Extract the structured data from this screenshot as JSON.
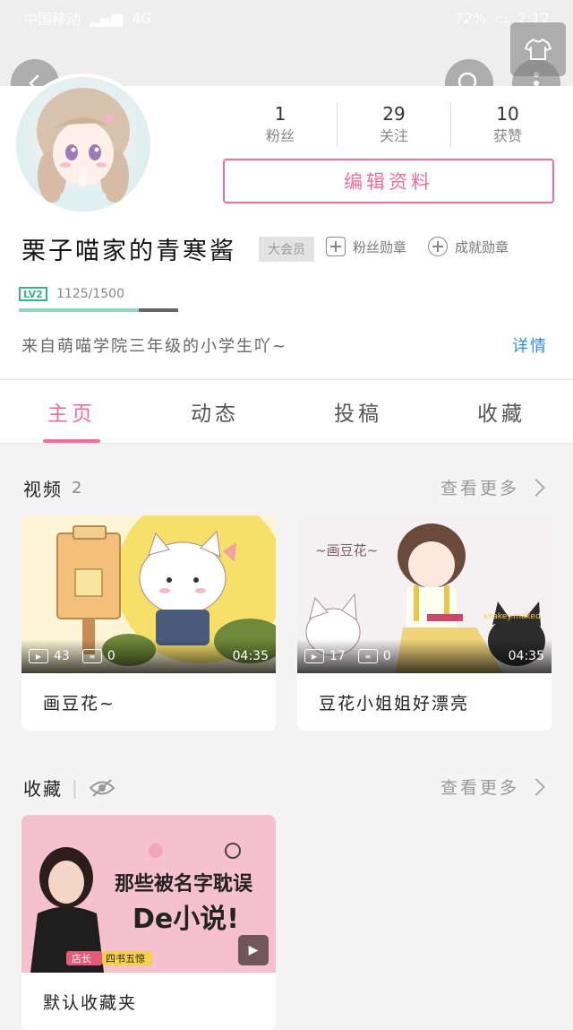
{
  "status_bar": {
    "carrier": "中国移动",
    "signal": "4G",
    "battery": "72%",
    "time": "2:12"
  },
  "profile": {
    "stats": [
      {
        "value": "1",
        "label": "粉丝"
      },
      {
        "value": "29",
        "label": "关注"
      },
      {
        "value": "10",
        "label": "获赞"
      }
    ],
    "edit_button": "编辑资料",
    "username": "栗子喵家的青寒酱",
    "vip_badge": "大会员",
    "fan_medal": "粉丝勋章",
    "achievement_medal": "成就勋章",
    "level": {
      "tag": "LV2",
      "progress_text": "1125/1500",
      "progress": 0.75
    },
    "bio": "来自萌喵学院三年级的小学生吖~",
    "detail_link": "详情"
  },
  "tabs": [
    {
      "label": "主页",
      "active": true
    },
    {
      "label": "动态",
      "active": false
    },
    {
      "label": "投稿",
      "active": false
    },
    {
      "label": "收藏",
      "active": false
    }
  ],
  "videos_section": {
    "title": "视频",
    "count": "2",
    "more": "查看更多",
    "items": [
      {
        "title": "画豆花~",
        "plays": "43",
        "danmaku": "0",
        "duration": "04:35"
      },
      {
        "title": "豆花小姐姐好漂亮",
        "plays": "17",
        "danmaku": "0",
        "duration": "04:35"
      }
    ],
    "thumb2_text": {
      "banner": "~画豆花~",
      "tag": "snakey.maked"
    }
  },
  "favorites_section": {
    "title": "收藏",
    "more": "查看更多",
    "items": [
      {
        "title": "默认收藏夹",
        "thumb_line1": "那些被名字耽误",
        "thumb_line2": "De小说!",
        "thumb_tag1": "店长",
        "thumb_tag2": "四书五惊"
      }
    ]
  },
  "colors": {
    "accent": "#ee6f97",
    "link": "#2f8ee0",
    "level": "#35b583"
  }
}
